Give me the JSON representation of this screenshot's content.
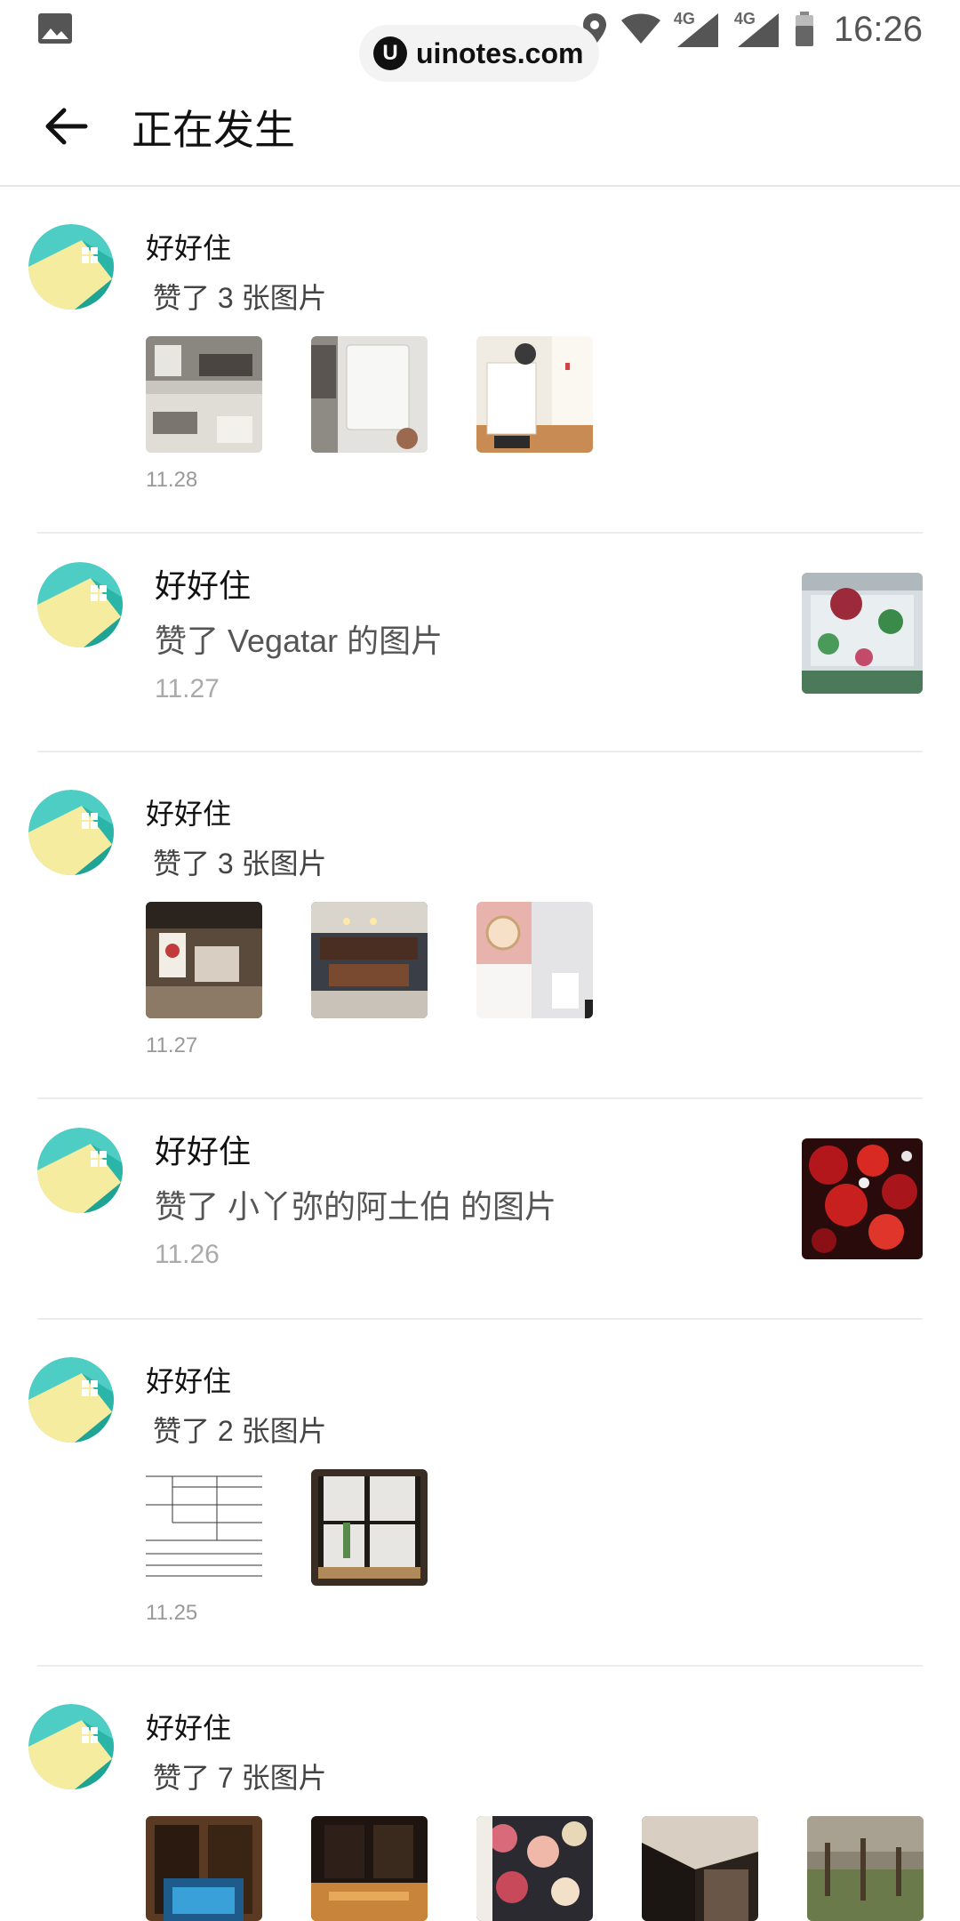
{
  "status_bar": {
    "time": "16:26",
    "network_1": "4G",
    "network_2": "4G",
    "watermark": "uinotes.com",
    "watermark_logo": "U"
  },
  "header": {
    "title": "正在发生",
    "back_icon": "arrow-left-icon"
  },
  "feed": [
    {
      "name": "好好住",
      "action": "赞了 3 张图片",
      "date": "11.28",
      "layout": "multi",
      "thumbs": 3
    },
    {
      "name": "好好住",
      "action": "赞了 Vegatar 的图片",
      "date": "11.27",
      "layout": "single"
    },
    {
      "name": "好好住",
      "action": "赞了 3 张图片",
      "date": "11.27",
      "layout": "multi",
      "thumbs": 3
    },
    {
      "name": "好好住",
      "action": "赞了 小丫弥的阿土伯 的图片",
      "date": "11.26",
      "layout": "single"
    },
    {
      "name": "好好住",
      "action": "赞了 2 张图片",
      "date": "11.25",
      "layout": "multi",
      "thumbs": 2
    },
    {
      "name": "好好住",
      "action": "赞了 7 张图片",
      "date": "",
      "layout": "multi",
      "thumbs": 5
    }
  ],
  "colors": {
    "avatar_teal": "#4ecdc4",
    "avatar_yellow": "#f6eca0",
    "divider": "#ececec"
  }
}
